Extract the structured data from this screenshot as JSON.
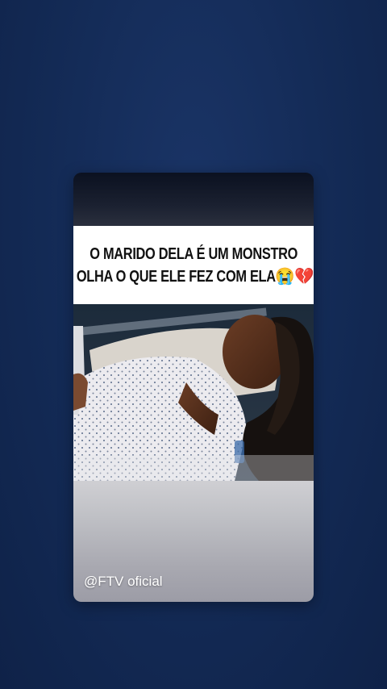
{
  "story": {
    "caption_line1": "O MARIDO DELA É UM MONSTRO",
    "caption_line2": "OLHA O QUE ELE FEZ COM ELA",
    "caption_emojis": "😭💔",
    "watermark": "@FTV oficial"
  },
  "colors": {
    "background": "#132a55",
    "caption_bg": "#ffffff",
    "caption_text": "#111111",
    "watermark_text": "#ffffff"
  }
}
